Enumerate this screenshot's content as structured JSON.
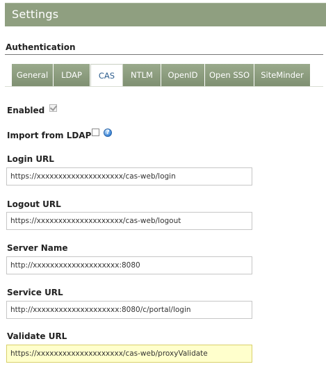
{
  "header": {
    "title": "Settings"
  },
  "section": {
    "title": "Authentication"
  },
  "tabs": [
    {
      "label": "General",
      "active": false
    },
    {
      "label": "LDAP",
      "active": false
    },
    {
      "label": "CAS",
      "active": true
    },
    {
      "label": "NTLM",
      "active": false
    },
    {
      "label": "OpenID",
      "active": false
    },
    {
      "label": "Open SSO",
      "active": false
    },
    {
      "label": "SiteMinder",
      "active": false
    }
  ],
  "enabled": {
    "label": "Enabled",
    "checked": true
  },
  "import_ldap": {
    "label": "Import from LDAP",
    "checked": false,
    "help_icon": "help-icon"
  },
  "fields": {
    "login_url": {
      "label": "Login URL",
      "value": "https://xxxxxxxxxxxxxxxxxxxx/cas-web/login"
    },
    "logout_url": {
      "label": "Logout URL",
      "value": "https://xxxxxxxxxxxxxxxxxxxx/cas-web/logout"
    },
    "server_name": {
      "label": "Server Name",
      "value": "http://xxxxxxxxxxxxxxxxxxxx:8080"
    },
    "service_url": {
      "label": "Service URL",
      "value": "http://xxxxxxxxxxxxxxxxxxxx:8080/c/portal/login"
    },
    "validate_url": {
      "label": "Validate URL",
      "value": "https://xxxxxxxxxxxxxxxxxxxx/cas-web/proxyValidate"
    }
  },
  "colors": {
    "header_bg": "#8f9f80",
    "tab_active_text": "#2f5f8f",
    "focused_input_bg": "#ffffcc"
  }
}
